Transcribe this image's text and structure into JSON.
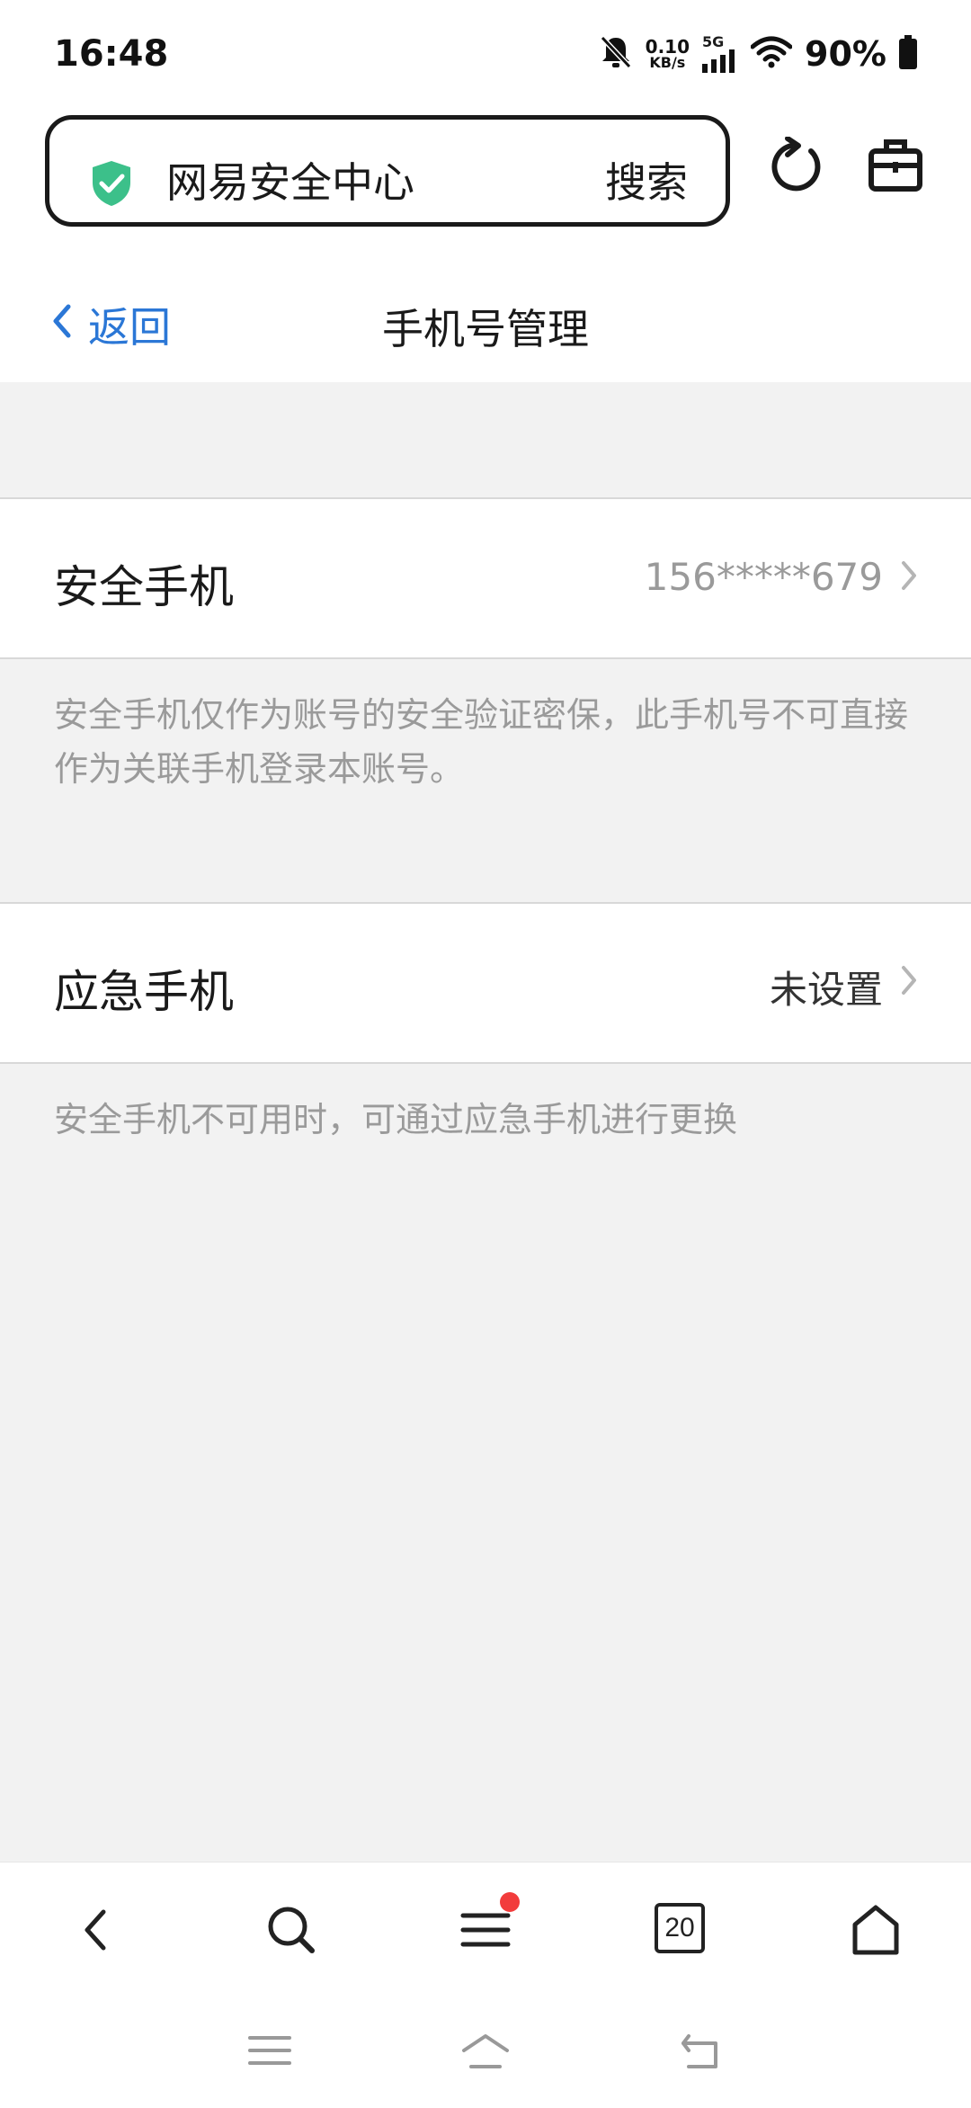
{
  "status_bar": {
    "time": "16:48",
    "net_speed_value": "0.10",
    "net_speed_unit": "KB/s",
    "network_type": "5G",
    "battery": "90%",
    "icons": [
      "bell-muted-icon",
      "signal-icon",
      "wifi-icon",
      "battery-icon"
    ]
  },
  "browser": {
    "site_title": "网易安全中心",
    "search_label": "搜索",
    "icons": [
      "shield-check-icon",
      "refresh-icon",
      "toolbox-icon"
    ],
    "accent_color": "#3cc08a"
  },
  "nav": {
    "back_label": "返回",
    "title": "手机号管理",
    "link_color": "#2b77d6"
  },
  "security_phone": {
    "label": "安全手机",
    "value": "156*****679",
    "note": "安全手机仅作为账号的安全验证密保，此手机号不可直接作为关联手机登录本账号。"
  },
  "emergency_phone": {
    "label": "应急手机",
    "value": "未设置",
    "note": "安全手机不可用时，可通过应急手机进行更换"
  },
  "bottom_toolbar": {
    "tab_count": "20",
    "icons": [
      "back-icon",
      "search-icon",
      "menu-icon",
      "tabs-icon",
      "home-icon"
    ],
    "badge_color": "#f23c3c"
  },
  "system_nav": {
    "icons": [
      "recents-icon",
      "home-icon",
      "back-icon"
    ]
  }
}
